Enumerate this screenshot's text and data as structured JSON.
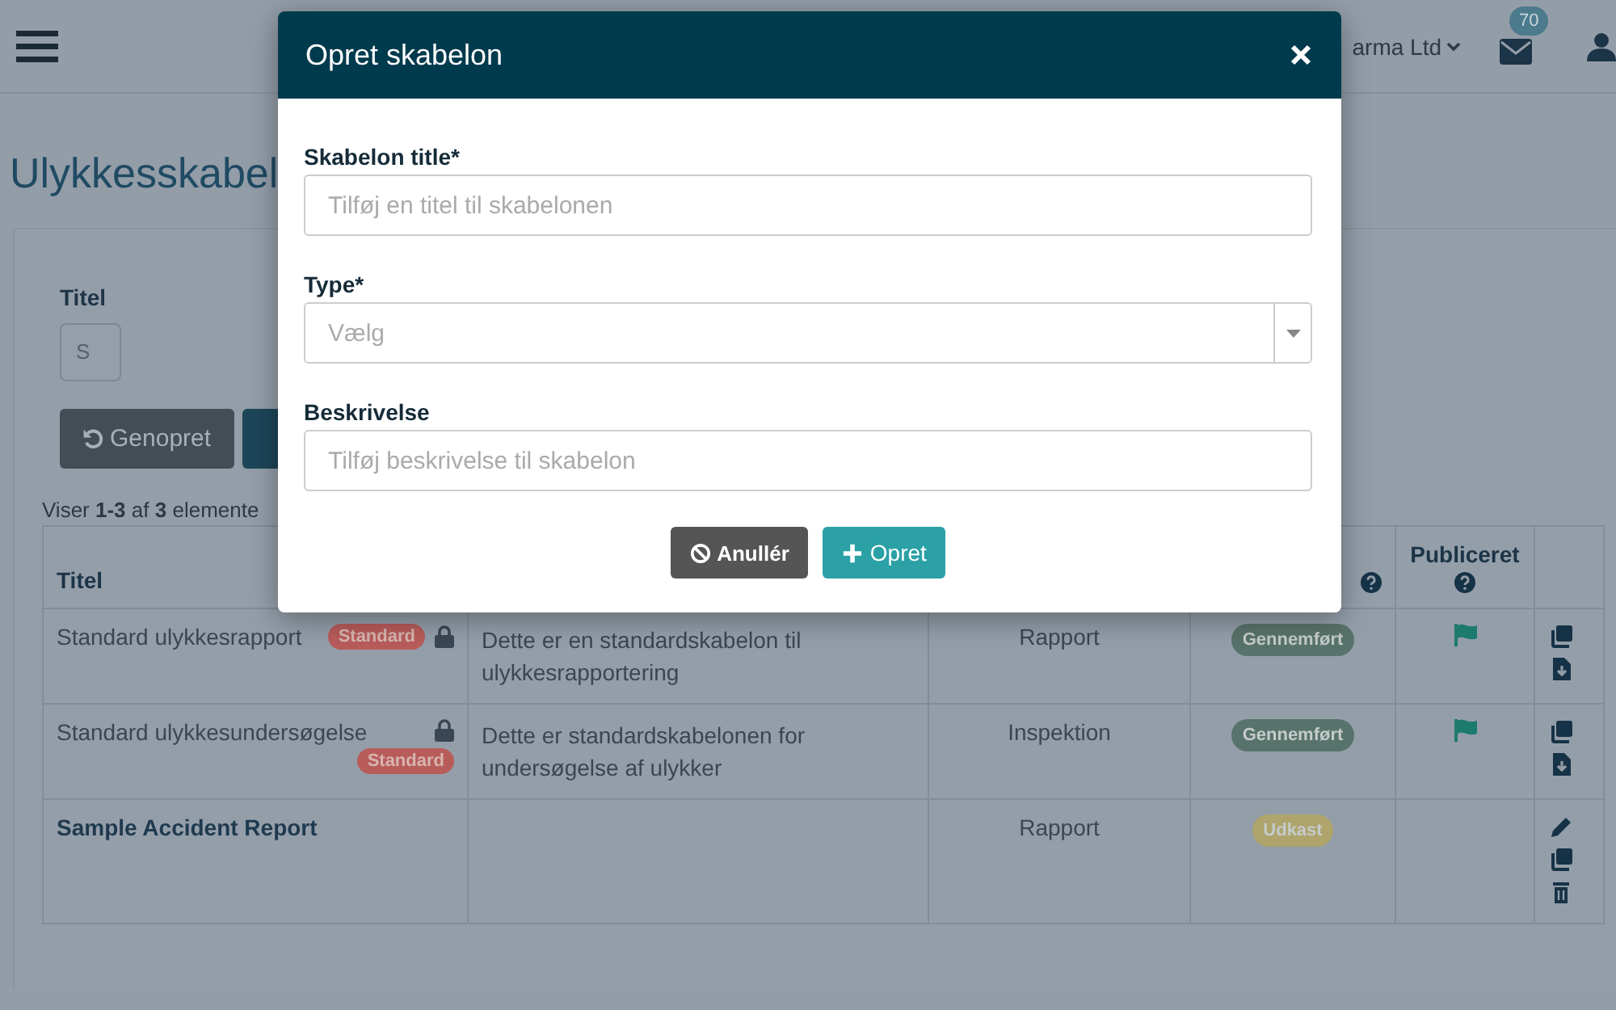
{
  "header": {
    "company": "arma Ltd",
    "mail_count": "70"
  },
  "page_title": "Ulykkesskabel",
  "filter": {
    "label": "Titel",
    "placeholder": "S",
    "buttons": [
      {
        "label": "Genopret",
        "kind": "reset"
      },
      {
        "kind": "search"
      }
    ]
  },
  "summary": "Viser **1-3** af **3** elemente",
  "table": {
    "columns": [
      {
        "label": "Titel",
        "help": false
      },
      {},
      {},
      {
        "help": true
      },
      {
        "label": "Publiceret",
        "help": true
      },
      {
        "help": false
      }
    ],
    "rows": [
      {
        "title": "Standard ulykkesrapport",
        "bold": false,
        "badge": "Standard",
        "badge_below": false,
        "locked": true,
        "description": "Dette er en standardskabelon til ulykkesrapportering",
        "type": "Rapport",
        "status": {
          "label": "Gennemført",
          "color": "#58736b"
        },
        "published": true,
        "actions": [
          {
            "kind": "copy"
          },
          {
            "kind": "download"
          }
        ]
      },
      {
        "title": "Standard ulykkesundersøgelse",
        "bold": false,
        "badge": "Standard",
        "badge_below": true,
        "locked": true,
        "description": "Dette er standardskabelonen for undersøgelse af ulykker",
        "type": "Inspektion",
        "status": {
          "label": "Gennemført",
          "color": "#58736b"
        },
        "published": true,
        "actions": [
          {
            "kind": "copy"
          },
          {
            "kind": "download"
          }
        ]
      },
      {
        "title": "Sample Accident Report",
        "bold": true,
        "locked": false,
        "type": "Rapport",
        "status": {
          "label": "Udkast",
          "color": "#aea46c"
        },
        "published": false,
        "actions": [
          {
            "kind": "edit"
          },
          {
            "kind": "copy"
          },
          {
            "kind": "delete"
          }
        ]
      }
    ]
  },
  "modal": {
    "title": "Opret skabelon",
    "fields": [
      {
        "label": "Skabelon title*",
        "placeholder": "Tilføj en titel til skabelonen",
        "kind": "text"
      },
      {
        "label": "Type*",
        "placeholder": "Vælg",
        "kind": "select"
      },
      {
        "label": "Beskrivelse",
        "placeholder": "Tilføj beskrivelse til skabelon",
        "kind": "text"
      }
    ],
    "buttons": [
      {
        "label": "Anullér",
        "kind": "cancel"
      },
      {
        "label": "Opret",
        "kind": "create"
      }
    ]
  }
}
